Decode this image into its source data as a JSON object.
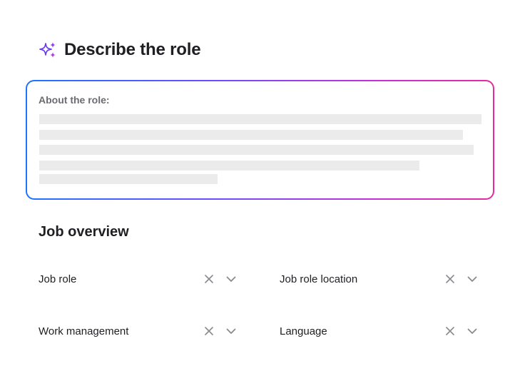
{
  "header": {
    "icon": "sparkle-icon",
    "title": "Describe the role"
  },
  "about": {
    "label": "About the role:",
    "gradient_colors": [
      "#1e73ff",
      "#6b4cff",
      "#c62fd8",
      "#e62aa0"
    ]
  },
  "overview": {
    "title": "Job overview",
    "fields": [
      {
        "label": "Job role",
        "clear_icon": "close-icon",
        "expand_icon": "chevron-down-icon"
      },
      {
        "label": "Job role location",
        "clear_icon": "close-icon",
        "expand_icon": "chevron-down-icon"
      },
      {
        "label": "Work management",
        "clear_icon": "close-icon",
        "expand_icon": "chevron-down-icon"
      },
      {
        "label": "Language",
        "clear_icon": "close-icon",
        "expand_icon": "chevron-down-icon"
      }
    ]
  },
  "colors": {
    "accent_blue": "#1e73ff",
    "accent_pink": "#e62aa0",
    "sparkle_purple": "#6b3cf0",
    "text_dark": "#1f1f23",
    "text_muted": "#6b6b70",
    "icon_gray": "#8a8a8e",
    "skeleton": "#ebebeb"
  }
}
